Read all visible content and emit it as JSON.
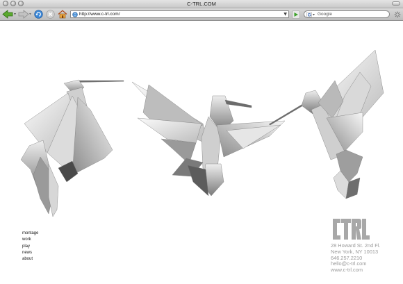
{
  "window": {
    "title": "C-TRL.COM"
  },
  "toolbar": {
    "url": "http://www.c-trl.com/",
    "search_placeholder": "Google"
  },
  "nav": {
    "items": [
      "montage",
      "work",
      "play",
      "news",
      "about"
    ]
  },
  "logo": {
    "text": "CTRL"
  },
  "contact": {
    "street": "28 Howard St. 2nd Fl.",
    "city": "New York, NY 10013",
    "phone": "646.257.2210",
    "email": "hello@c-trl.com",
    "web": "www.c-trl.com"
  },
  "icons": [
    "back-arrow-icon",
    "forward-arrow-icon",
    "reload-icon",
    "stop-icon",
    "home-icon",
    "globe-icon",
    "go-arrow-icon",
    "google-icon",
    "chevron-down-icon",
    "activity-spinner-icon"
  ]
}
